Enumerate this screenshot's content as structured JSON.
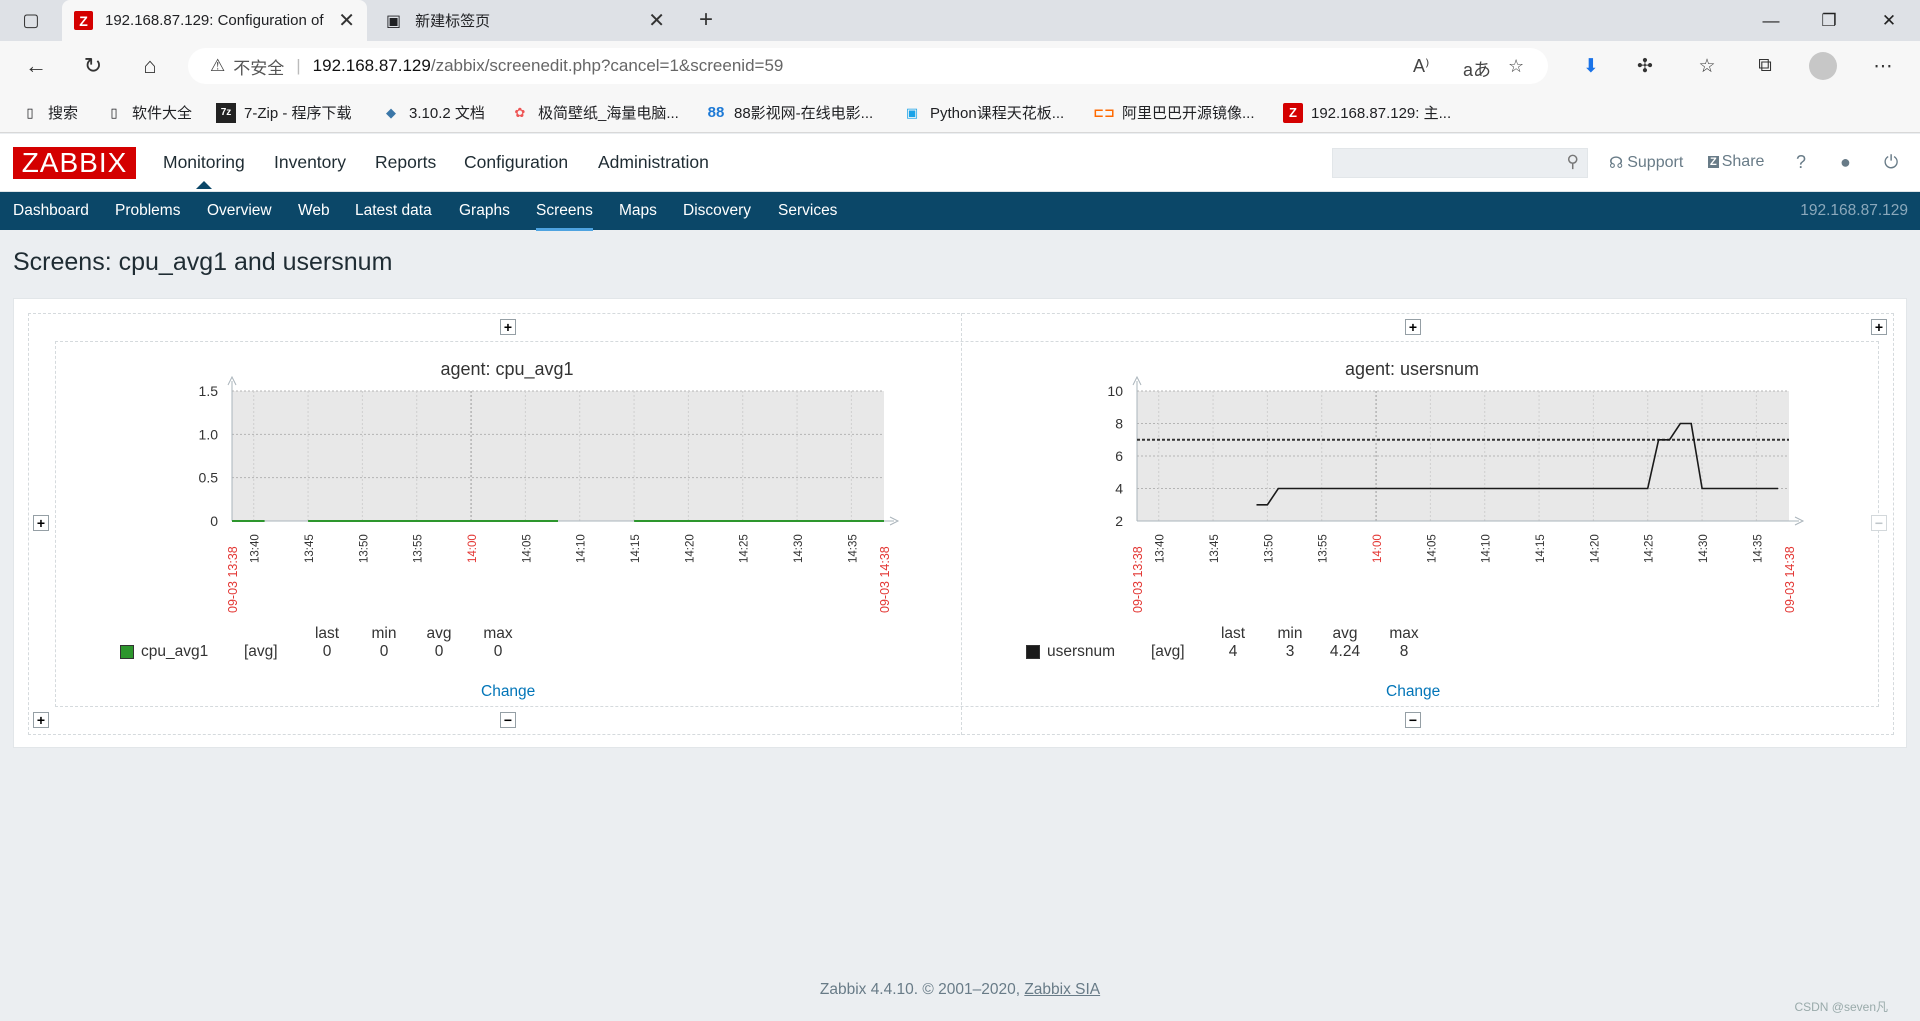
{
  "browser": {
    "tabs": [
      {
        "title": "192.168.87.129: Configuration of",
        "favicon": "Z"
      },
      {
        "title": "新建标签页"
      }
    ],
    "url": {
      "security_label": "不安全",
      "host": "192.168.87.129",
      "path": "/zabbix/screenedit.php?cancel=1&screenid=59"
    },
    "bookmarks": [
      {
        "label": "搜索"
      },
      {
        "label": "软件大全"
      },
      {
        "label": "7-Zip - 程序下载",
        "icon_text": "7z"
      },
      {
        "label": "3.10.2 文档"
      },
      {
        "label": "极简壁纸_海量电脑..."
      },
      {
        "label": "88影视网-在线电影...",
        "icon_text": "88"
      },
      {
        "label": "Python课程天花板..."
      },
      {
        "label": "阿里巴巴开源镜像..."
      },
      {
        "label": "192.168.87.129: 主...",
        "icon_text": "Z"
      }
    ]
  },
  "zabbix": {
    "logo": "ZABBIX",
    "main_menu": [
      "Monitoring",
      "Inventory",
      "Reports",
      "Configuration",
      "Administration"
    ],
    "support": "Support",
    "share": "Share",
    "help": "?",
    "sub_menu": [
      "Dashboard",
      "Problems",
      "Overview",
      "Web",
      "Latest data",
      "Graphs",
      "Screens",
      "Maps",
      "Discovery",
      "Services"
    ],
    "server_ip": "192.168.87.129",
    "page_title": "Screens: cpu_avg1 and usersnum",
    "footer": {
      "text": "Zabbix 4.4.10. © 2001–2020, ",
      "link": "Zabbix SIA"
    },
    "change_label": "Change"
  },
  "colors": {
    "brand_red": "#d40000",
    "nav_blue": "#0b4768",
    "link_blue": "#0275b8",
    "series_green": "#2d962d",
    "series_black": "#1a1a1a",
    "alert_red": "#e33734"
  },
  "watermark": "CSDN @seven凡",
  "chart_data": [
    {
      "type": "line",
      "title": "agent: cpu_avg1",
      "y_ticks": [
        "0",
        "0.5",
        "1.0",
        "1.5"
      ],
      "ylim": [
        0,
        1.5
      ],
      "x_ticks": [
        "13:40",
        "13:45",
        "13:50",
        "13:55",
        "14:00",
        "14:05",
        "14:10",
        "14:15",
        "14:20",
        "14:25",
        "14:30",
        "14:35"
      ],
      "x_start_label": "09-03 13:38",
      "x_end_label": "09-03 14:38",
      "highlight_tick": "14:00",
      "series": [
        {
          "name": "cpu_avg1",
          "func": "[avg]",
          "color": "#2d962d",
          "segments": [
            [
              [
                "13:38",
                0
              ],
              [
                "13:41",
                0
              ]
            ],
            [
              [
                "13:45",
                0
              ],
              [
                "14:08",
                0
              ]
            ],
            [
              [
                "14:15",
                0
              ],
              [
                "14:38",
                0
              ]
            ]
          ],
          "stats": {
            "last": "0",
            "min": "0",
            "avg": "0",
            "max": "0"
          }
        }
      ],
      "legend_headers": [
        "last",
        "min",
        "avg",
        "max"
      ]
    },
    {
      "type": "line",
      "title": "agent: usersnum",
      "y_ticks": [
        "2",
        "4",
        "6",
        "8",
        "10"
      ],
      "ylim": [
        2,
        10
      ],
      "x_ticks": [
        "13:40",
        "13:45",
        "13:50",
        "13:55",
        "14:00",
        "14:05",
        "14:10",
        "14:15",
        "14:20",
        "14:25",
        "14:30",
        "14:35"
      ],
      "x_start_label": "09-03 13:38",
      "x_end_label": "09-03 14:38",
      "highlight_tick": "14:00",
      "trigger_line": 7,
      "series": [
        {
          "name": "usersnum",
          "func": "[avg]",
          "color": "#1a1a1a",
          "points": [
            [
              "13:49",
              3
            ],
            [
              "13:50",
              3
            ],
            [
              "13:51",
              4
            ],
            [
              "14:25",
              4
            ],
            [
              "14:26",
              7
            ],
            [
              "14:27",
              7
            ],
            [
              "14:28",
              8
            ],
            [
              "14:29",
              8
            ],
            [
              "14:30",
              4
            ],
            [
              "14:37",
              4
            ]
          ],
          "stats": {
            "last": "4",
            "min": "3",
            "avg": "4.24",
            "max": "8"
          }
        }
      ],
      "legend_headers": [
        "last",
        "min",
        "avg",
        "max"
      ]
    }
  ]
}
